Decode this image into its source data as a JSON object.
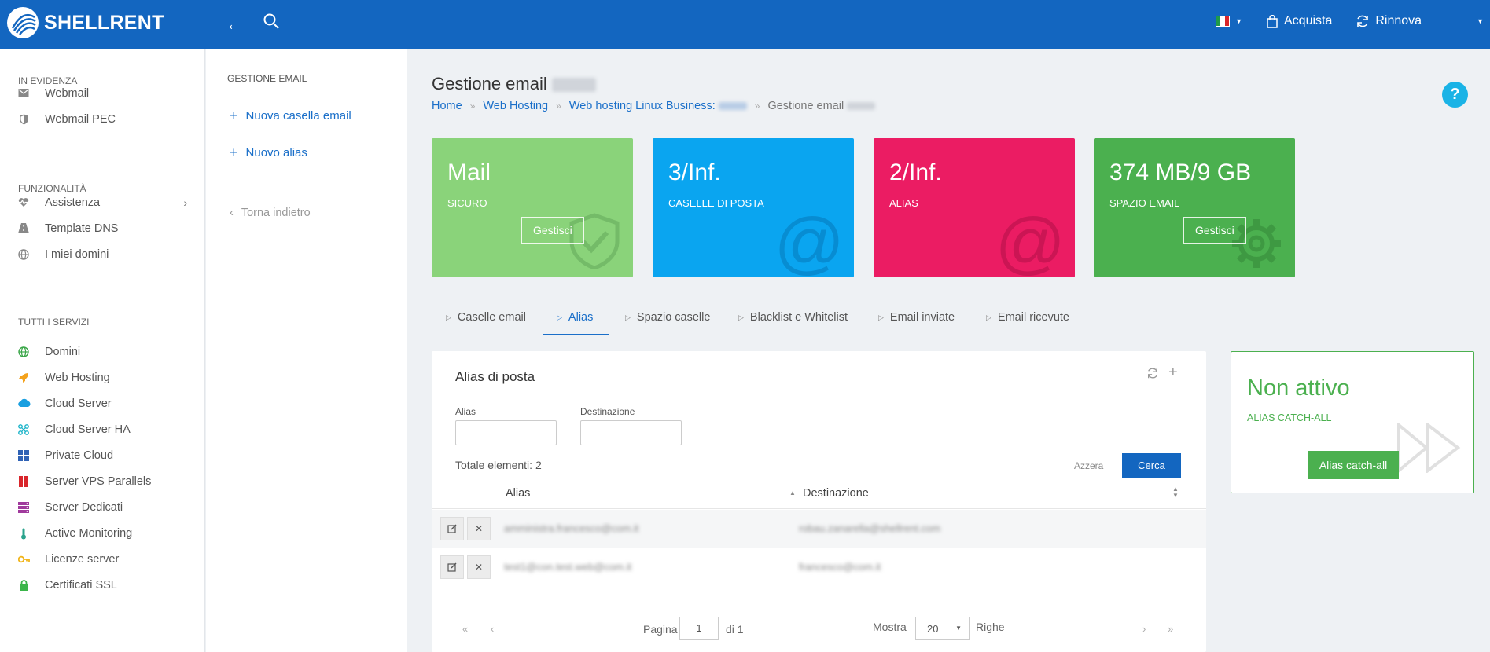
{
  "brand": {
    "name": "SHELLRENT"
  },
  "topbar": {
    "language": "it",
    "buy_label": "Acquista",
    "renew_label": "Rinnova"
  },
  "sidebar": {
    "sections": [
      {
        "title": "IN EVIDENZA",
        "items": [
          {
            "label": "Webmail",
            "icon": "mail-icon"
          },
          {
            "label": "Webmail PEC",
            "icon": "shield-icon"
          }
        ]
      },
      {
        "title": "FUNZIONALITÀ",
        "items": [
          {
            "label": "Assistenza",
            "icon": "heartbeat-icon"
          },
          {
            "label": "Template DNS",
            "icon": "road-icon"
          },
          {
            "label": "I miei domini",
            "icon": "globe-icon"
          }
        ]
      },
      {
        "title": "TUTTI I SERVIZI",
        "items": [
          {
            "label": "Domini",
            "icon": "globe-icon"
          },
          {
            "label": "Web Hosting",
            "icon": "rocket-icon"
          },
          {
            "label": "Cloud Server",
            "icon": "cloud-icon"
          },
          {
            "label": "Cloud Server HA",
            "icon": "network-icon"
          },
          {
            "label": "Private Cloud",
            "icon": "grid-icon"
          },
          {
            "label": "Server VPS Parallels",
            "icon": "parallels-icon"
          },
          {
            "label": "Server Dedicati",
            "icon": "server-icon"
          },
          {
            "label": "Active Monitoring",
            "icon": "thermometer-icon"
          },
          {
            "label": "Licenze server",
            "icon": "key-icon"
          },
          {
            "label": "Certificati SSL",
            "icon": "lock-icon"
          }
        ]
      }
    ]
  },
  "subpanel": {
    "title": "GESTIONE EMAIL",
    "new_mailbox": "Nuova casella email",
    "new_alias": "Nuovo alias",
    "back": "Torna indietro"
  },
  "page": {
    "title": "Gestione email",
    "breadcrumb": [
      "Home",
      "Web Hosting",
      "Web hosting Linux Business:",
      "Gestione email"
    ]
  },
  "cards": [
    {
      "value": "Mail",
      "label": "SICURO",
      "button": "Gestisci",
      "color": "#8ad37a",
      "icon": "shield-check-icon"
    },
    {
      "value": "3/Inf.",
      "label": "CASELLE DI POSTA",
      "color": "#0aa5f0",
      "icon": "at-icon"
    },
    {
      "value": "2/Inf.",
      "label": "ALIAS",
      "color": "#eb1c63",
      "icon": "at-icon"
    },
    {
      "value": "374 MB/9 GB",
      "label": "SPAZIO EMAIL",
      "button": "Gestisci",
      "color": "#4bb04f",
      "icon": "gear-icon"
    }
  ],
  "tabs": [
    "Caselle email",
    "Alias",
    "Spazio caselle",
    "Blacklist e Whitelist",
    "Email inviate",
    "Email ricevute"
  ],
  "active_tab": "Alias",
  "alias_panel": {
    "title": "Alias di posta",
    "filter_alias_label": "Alias",
    "filter_dest_label": "Destinazione",
    "total": "Totale elementi: 2",
    "reset": "Azzera",
    "search": "Cerca",
    "col_alias": "Alias",
    "col_dest": "Destinazione",
    "rows": [
      {
        "alias": "amministra.francesco@com.it",
        "dest": "robau.zanarella@shellrent.com"
      },
      {
        "alias": "test1@con.test.web@com.it",
        "dest": "francesco@com.it"
      }
    ],
    "pager": {
      "page_label": "Pagina",
      "page": "1",
      "of": "di 1",
      "show": "Mostra",
      "per_page": "20",
      "rows": "Righe"
    }
  },
  "catch_all": {
    "status": "Non attivo",
    "label": "ALIAS CATCH-ALL",
    "button": "Alias catch-all"
  }
}
